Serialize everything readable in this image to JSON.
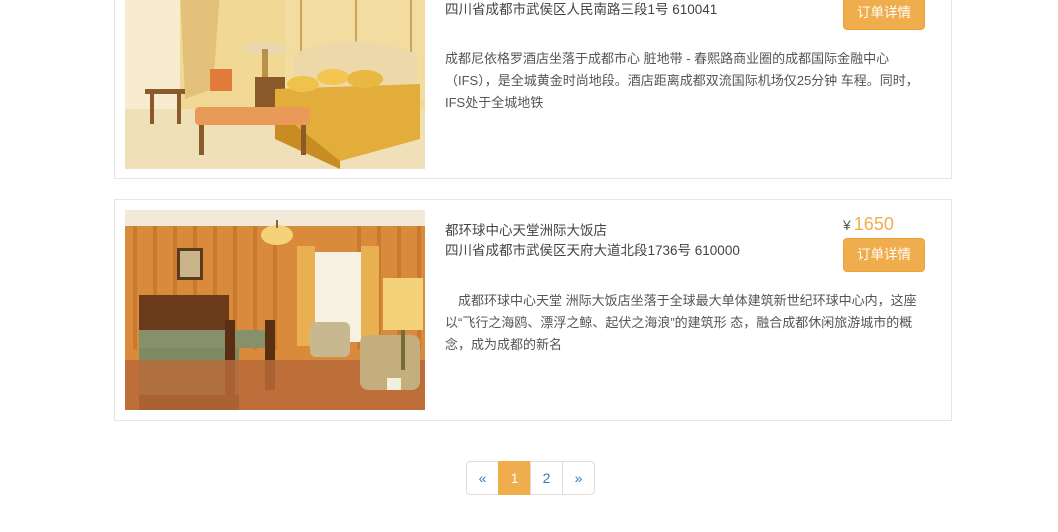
{
  "hotels": [
    {
      "address": "四川省成都市武侯区人民南路三段1号 610041",
      "description": "成都尼依格罗酒店坐落于成都市心  脏地带 - 春熙路商业圈的成都国际金融中心（IFS），是全城黄金时尚地段。酒店距离成都双流国际机场仅25分钟  车程。同时，IFS处于全城地铁",
      "button_label": "订单详情"
    },
    {
      "name": "都环球中心天堂洲际大饭店",
      "address": "四川省成都市武侯区天府大道北段1736号 610000",
      "currency": "¥",
      "price": "1650",
      "description": "　成都环球中心天堂  洲际大饭店坐落于全球最大单体建筑新世纪环球中心内，这座以“飞行之海鸥、漂浮之鲸、起伏之海浪”的建筑形  态，融合成都休闲旅游城市的概念，成为成都的新名",
      "button_label": "订单详情"
    }
  ],
  "pagination": {
    "prev": "«",
    "pages": [
      "1",
      "2"
    ],
    "next": "»",
    "active": "1"
  },
  "colors": {
    "accent": "#f0ad4e",
    "link": "#337ab7",
    "border": "#e6e6e6"
  }
}
